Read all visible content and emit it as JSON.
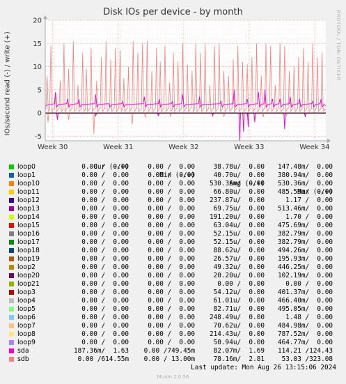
{
  "chart_data": {
    "type": "line",
    "title": "Disk IOs per device - by month",
    "ylabel": "IOs/second read (-) / write (+)",
    "ylim": [
      -6,
      20
    ],
    "yticks": [
      -5,
      0,
      5,
      10,
      15,
      20
    ],
    "x_domain": [
      0,
      30
    ],
    "xticks": [
      {
        "label": "Week 30",
        "pos": 0.8
      },
      {
        "label": "Week 31",
        "pos": 7.8
      },
      {
        "label": "Week 32",
        "pos": 14.8
      },
      {
        "label": "Week 33",
        "pos": 21.8
      },
      {
        "label": "Week 34",
        "pos": 28.8
      }
    ],
    "grid": true,
    "series": [
      {
        "name": "sdb",
        "color": "#f8817c",
        "write_peaks": [
          [
            0.2,
            8
          ],
          [
            0.6,
            14.5
          ],
          [
            1.1,
            3.5
          ],
          [
            1.6,
            7
          ],
          [
            2.0,
            15
          ],
          [
            2.5,
            9.5
          ],
          [
            3.0,
            15.5
          ],
          [
            3.5,
            6
          ],
          [
            4.0,
            13
          ],
          [
            4.4,
            9.5
          ],
          [
            4.9,
            14
          ],
          [
            5.5,
            7
          ],
          [
            6.0,
            12
          ],
          [
            6.5,
            15.5
          ],
          [
            7.0,
            11.5
          ],
          [
            7.5,
            14
          ],
          [
            8.0,
            13.5
          ],
          [
            8.4,
            7.5
          ],
          [
            8.9,
            10
          ],
          [
            9.4,
            15.5
          ],
          [
            9.9,
            13
          ],
          [
            10.4,
            15
          ],
          [
            10.9,
            15.5
          ],
          [
            11.4,
            9
          ],
          [
            11.9,
            14
          ],
          [
            12.3,
            11
          ],
          [
            12.8,
            14.5
          ],
          [
            13.3,
            6.5
          ],
          [
            13.7,
            13
          ],
          [
            14.2,
            11
          ],
          [
            14.7,
            15
          ],
          [
            15.2,
            10.5
          ],
          [
            15.7,
            9
          ],
          [
            16.1,
            15
          ],
          [
            16.6,
            13
          ],
          [
            17.1,
            15
          ],
          [
            17.6,
            6
          ],
          [
            18.1,
            14.5
          ],
          [
            18.6,
            15
          ],
          [
            19.1,
            9
          ],
          [
            19.6,
            8
          ],
          [
            20.1,
            11.5
          ],
          [
            20.6,
            14.5
          ],
          [
            21.1,
            11
          ],
          [
            21.6,
            10.5
          ],
          [
            22.1,
            12
          ],
          [
            22.6,
            15
          ],
          [
            23.1,
            8
          ],
          [
            23.6,
            15
          ],
          [
            24.1,
            14.5
          ],
          [
            24.6,
            6
          ],
          [
            25.1,
            15
          ],
          [
            25.6,
            14.5
          ],
          [
            26.1,
            9
          ],
          [
            26.6,
            10
          ],
          [
            27.1,
            12
          ],
          [
            27.6,
            14
          ],
          [
            28.1,
            11
          ],
          [
            28.6,
            15
          ],
          [
            29.1,
            12
          ],
          [
            29.6,
            13
          ]
        ],
        "read_dips": [
          [
            0.3,
            -2
          ],
          [
            2.5,
            -1.5
          ],
          [
            5.2,
            -4.5
          ],
          [
            9.3,
            -2.5
          ],
          [
            10.7,
            -1
          ],
          [
            13.4,
            -0.8
          ],
          [
            19.1,
            -0.8
          ],
          [
            21.6,
            -0.8
          ],
          [
            23.3,
            -0.9
          ],
          [
            25.8,
            -0.6
          ]
        ]
      },
      {
        "name": "sda",
        "color": "#e30fcf",
        "write_peaks": [
          [
            1.1,
            4.5
          ],
          [
            2.4,
            3
          ],
          [
            3.6,
            3
          ],
          [
            5.4,
            4
          ],
          [
            6.8,
            2
          ],
          [
            8.3,
            2.5
          ],
          [
            10.6,
            3.5
          ],
          [
            12.2,
            3
          ],
          [
            13.6,
            2.5
          ],
          [
            14.7,
            4
          ],
          [
            16.5,
            3.5
          ],
          [
            18.8,
            2.5
          ],
          [
            20.2,
            5
          ],
          [
            21.6,
            3
          ],
          [
            22.8,
            4.5
          ],
          [
            23.5,
            5
          ],
          [
            24.3,
            3
          ],
          [
            25.1,
            3
          ],
          [
            26.2,
            3.5
          ],
          [
            27.2,
            3
          ],
          [
            28.6,
            2.5
          ],
          [
            29.5,
            3
          ]
        ],
        "read_dips": [
          [
            1.3,
            -1.5
          ],
          [
            5.4,
            -0.6
          ],
          [
            12.1,
            -0.7
          ],
          [
            17.9,
            -0.6
          ],
          [
            20.8,
            -6
          ],
          [
            21.2,
            -4
          ],
          [
            21.7,
            -3
          ],
          [
            22.4,
            -2
          ],
          [
            25.6,
            -3.5
          ],
          [
            27.8,
            -0.9
          ]
        ]
      }
    ]
  },
  "legend": {
    "headers": {
      "cur": "Cur (-/+)",
      "min": "Min (-/+)",
      "avg": "Avg (-/+)",
      "max": "Max (-/+)"
    },
    "rows": [
      {
        "name": "loop0",
        "color": "#00cc00",
        "cur": "0.00 /  0.00",
        "min": "0.00 /  0.00",
        "avg": "38.78u/  0.00",
        "max": "147.48m/  0.00"
      },
      {
        "name": "loop1",
        "color": "#0066b3",
        "cur": "0.00 /  0.00",
        "min": "0.00 /  0.00",
        "avg": "40.70u/  0.00",
        "max": "380.94m/  0.00"
      },
      {
        "name": "loop10",
        "color": "#ff8000",
        "cur": "0.00 /  0.00",
        "min": "0.00 /  0.00",
        "avg": "530.36m/  0.00",
        "max": "530.36m/  0.00"
      },
      {
        "name": "loop11",
        "color": "#ffcc00",
        "cur": "0.00 /  0.00",
        "min": "0.00 /  0.00",
        "avg": "66.80u/  0.00",
        "max": "485.59m/  0.00"
      },
      {
        "name": "loop12",
        "color": "#330099",
        "cur": "0.00 /  0.00",
        "min": "0.00 /  0.00",
        "avg": "237.87u/  0.00",
        "max": "1.17 /  0.00"
      },
      {
        "name": "loop13",
        "color": "#990099",
        "cur": "0.00 /  0.00",
        "min": "0.00 /  0.00",
        "avg": "69.75u/  0.00",
        "max": "513.46m/  0.00"
      },
      {
        "name": "loop14",
        "color": "#ccff00",
        "cur": "0.00 /  0.00",
        "min": "0.00 /  0.00",
        "avg": "191.20u/  0.00",
        "max": "1.70 /  0.00"
      },
      {
        "name": "loop15",
        "color": "#ff0000",
        "cur": "0.00 /  0.00",
        "min": "0.00 /  0.00",
        "avg": "63.04u/  0.00",
        "max": "475.69m/  0.00"
      },
      {
        "name": "loop16",
        "color": "#808080",
        "cur": "0.00 /  0.00",
        "min": "0.00 /  0.00",
        "avg": "52.15u/  0.00",
        "max": "382.79m/  0.00"
      },
      {
        "name": "loop17",
        "color": "#008f00",
        "cur": "0.00 /  0.00",
        "min": "0.00 /  0.00",
        "avg": "52.15u/  0.00",
        "max": "382.79m/  0.00"
      },
      {
        "name": "loop18",
        "color": "#00487d",
        "cur": "0.00 /  0.00",
        "min": "0.00 /  0.00",
        "avg": "88.62u/  0.00",
        "max": "494.26m/  0.00"
      },
      {
        "name": "loop19",
        "color": "#b35a00",
        "cur": "0.00 /  0.00",
        "min": "0.00 /  0.00",
        "avg": "26.57u/  0.00",
        "max": "195.93m/  0.00"
      },
      {
        "name": "loop2",
        "color": "#b38f00",
        "cur": "0.00 /  0.00",
        "min": "0.00 /  0.00",
        "avg": "49.32u/  0.00",
        "max": "446.25m/  0.00"
      },
      {
        "name": "loop20",
        "color": "#6b006b",
        "cur": "0.00 /  0.00",
        "min": "0.00 /  0.00",
        "avg": "20.20u/  0.00",
        "max": "102.19m/  0.00"
      },
      {
        "name": "loop21",
        "color": "#8fb300",
        "cur": "0.00 /  0.00",
        "min": "0.00 /  0.00",
        "avg": "0.00 /  0.00",
        "max": "0.00 /  0.00"
      },
      {
        "name": "loop3",
        "color": "#b30000",
        "cur": "0.00 /  0.00",
        "min": "0.00 /  0.00",
        "avg": "54.12u/  0.00",
        "max": "401.37m/  0.00"
      },
      {
        "name": "loop4",
        "color": "#bebebe",
        "cur": "0.00 /  0.00",
        "min": "0.00 /  0.00",
        "avg": "61.01u/  0.00",
        "max": "466.40m/  0.00"
      },
      {
        "name": "loop5",
        "color": "#80ff80",
        "cur": "0.00 /  0.00",
        "min": "0.00 /  0.00",
        "avg": "82.71u/  0.00",
        "max": "495.05m/  0.00"
      },
      {
        "name": "loop6",
        "color": "#80c9ff",
        "cur": "0.00 /  0.00",
        "min": "0.00 /  0.00",
        "avg": "248.49u/  0.00",
        "max": "1.48 /  0.00"
      },
      {
        "name": "loop7",
        "color": "#ffc080",
        "cur": "0.00 /  0.00",
        "min": "0.00 /  0.00",
        "avg": "70.62u/  0.00",
        "max": "484.98m/  0.00"
      },
      {
        "name": "loop8",
        "color": "#ffe680",
        "cur": "0.00 /  0.00",
        "min": "0.00 /  0.00",
        "avg": "214.43u/  0.00",
        "max": "787.52m/  0.00"
      },
      {
        "name": "loop9",
        "color": "#aa80ff",
        "cur": "0.00 /  0.00",
        "min": "0.00 /  0.00",
        "avg": "50.94u/  0.00",
        "max": "464.77m/  0.00"
      },
      {
        "name": "sda",
        "color": "#ee00cc",
        "cur": "187.36m/  1.63",
        "min": "0.00 /749.45m",
        "avg": "82.07m/  1.69",
        "max": "114.21 /124.43"
      },
      {
        "name": "sdb",
        "color": "#ff8080",
        "cur": "0.00 /614.55m",
        "min": "0.00 / 13.00m",
        "avg": "78.16m/  2.81",
        "max": "53.03 /323.08"
      }
    ]
  },
  "last_update": "Last update: Mon Aug 26 13:15:06 2024",
  "footer": "Munin 2.0.56",
  "watermark": "RRDTOOL / TOBI OETIKER"
}
